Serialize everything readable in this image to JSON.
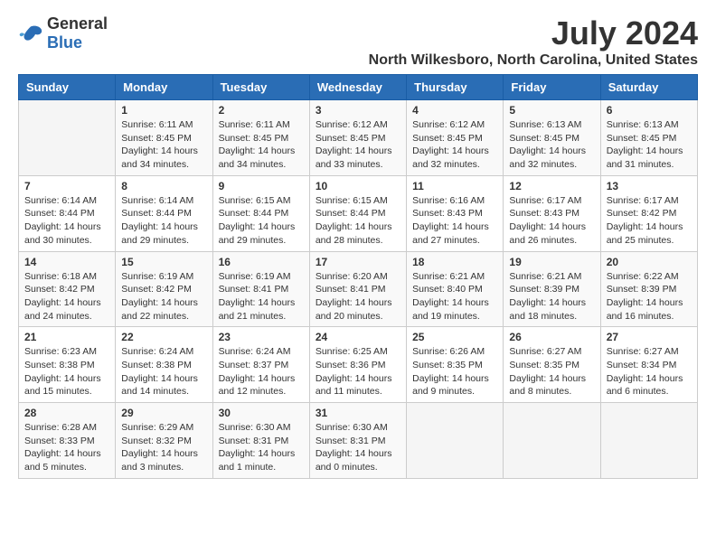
{
  "logo": {
    "text_general": "General",
    "text_blue": "Blue"
  },
  "title": "July 2024",
  "subtitle": "North Wilkesboro, North Carolina, United States",
  "days_header": [
    "Sunday",
    "Monday",
    "Tuesday",
    "Wednesday",
    "Thursday",
    "Friday",
    "Saturday"
  ],
  "weeks": [
    [
      {
        "day": "",
        "info": ""
      },
      {
        "day": "1",
        "info": "Sunrise: 6:11 AM\nSunset: 8:45 PM\nDaylight: 14 hours\nand 34 minutes."
      },
      {
        "day": "2",
        "info": "Sunrise: 6:11 AM\nSunset: 8:45 PM\nDaylight: 14 hours\nand 34 minutes."
      },
      {
        "day": "3",
        "info": "Sunrise: 6:12 AM\nSunset: 8:45 PM\nDaylight: 14 hours\nand 33 minutes."
      },
      {
        "day": "4",
        "info": "Sunrise: 6:12 AM\nSunset: 8:45 PM\nDaylight: 14 hours\nand 32 minutes."
      },
      {
        "day": "5",
        "info": "Sunrise: 6:13 AM\nSunset: 8:45 PM\nDaylight: 14 hours\nand 32 minutes."
      },
      {
        "day": "6",
        "info": "Sunrise: 6:13 AM\nSunset: 8:45 PM\nDaylight: 14 hours\nand 31 minutes."
      }
    ],
    [
      {
        "day": "7",
        "info": "Sunrise: 6:14 AM\nSunset: 8:44 PM\nDaylight: 14 hours\nand 30 minutes."
      },
      {
        "day": "8",
        "info": "Sunrise: 6:14 AM\nSunset: 8:44 PM\nDaylight: 14 hours\nand 29 minutes."
      },
      {
        "day": "9",
        "info": "Sunrise: 6:15 AM\nSunset: 8:44 PM\nDaylight: 14 hours\nand 29 minutes."
      },
      {
        "day": "10",
        "info": "Sunrise: 6:15 AM\nSunset: 8:44 PM\nDaylight: 14 hours\nand 28 minutes."
      },
      {
        "day": "11",
        "info": "Sunrise: 6:16 AM\nSunset: 8:43 PM\nDaylight: 14 hours\nand 27 minutes."
      },
      {
        "day": "12",
        "info": "Sunrise: 6:17 AM\nSunset: 8:43 PM\nDaylight: 14 hours\nand 26 minutes."
      },
      {
        "day": "13",
        "info": "Sunrise: 6:17 AM\nSunset: 8:42 PM\nDaylight: 14 hours\nand 25 minutes."
      }
    ],
    [
      {
        "day": "14",
        "info": "Sunrise: 6:18 AM\nSunset: 8:42 PM\nDaylight: 14 hours\nand 24 minutes."
      },
      {
        "day": "15",
        "info": "Sunrise: 6:19 AM\nSunset: 8:42 PM\nDaylight: 14 hours\nand 22 minutes."
      },
      {
        "day": "16",
        "info": "Sunrise: 6:19 AM\nSunset: 8:41 PM\nDaylight: 14 hours\nand 21 minutes."
      },
      {
        "day": "17",
        "info": "Sunrise: 6:20 AM\nSunset: 8:41 PM\nDaylight: 14 hours\nand 20 minutes."
      },
      {
        "day": "18",
        "info": "Sunrise: 6:21 AM\nSunset: 8:40 PM\nDaylight: 14 hours\nand 19 minutes."
      },
      {
        "day": "19",
        "info": "Sunrise: 6:21 AM\nSunset: 8:39 PM\nDaylight: 14 hours\nand 18 minutes."
      },
      {
        "day": "20",
        "info": "Sunrise: 6:22 AM\nSunset: 8:39 PM\nDaylight: 14 hours\nand 16 minutes."
      }
    ],
    [
      {
        "day": "21",
        "info": "Sunrise: 6:23 AM\nSunset: 8:38 PM\nDaylight: 14 hours\nand 15 minutes."
      },
      {
        "day": "22",
        "info": "Sunrise: 6:24 AM\nSunset: 8:38 PM\nDaylight: 14 hours\nand 14 minutes."
      },
      {
        "day": "23",
        "info": "Sunrise: 6:24 AM\nSunset: 8:37 PM\nDaylight: 14 hours\nand 12 minutes."
      },
      {
        "day": "24",
        "info": "Sunrise: 6:25 AM\nSunset: 8:36 PM\nDaylight: 14 hours\nand 11 minutes."
      },
      {
        "day": "25",
        "info": "Sunrise: 6:26 AM\nSunset: 8:35 PM\nDaylight: 14 hours\nand 9 minutes."
      },
      {
        "day": "26",
        "info": "Sunrise: 6:27 AM\nSunset: 8:35 PM\nDaylight: 14 hours\nand 8 minutes."
      },
      {
        "day": "27",
        "info": "Sunrise: 6:27 AM\nSunset: 8:34 PM\nDaylight: 14 hours\nand 6 minutes."
      }
    ],
    [
      {
        "day": "28",
        "info": "Sunrise: 6:28 AM\nSunset: 8:33 PM\nDaylight: 14 hours\nand 5 minutes."
      },
      {
        "day": "29",
        "info": "Sunrise: 6:29 AM\nSunset: 8:32 PM\nDaylight: 14 hours\nand 3 minutes."
      },
      {
        "day": "30",
        "info": "Sunrise: 6:30 AM\nSunset: 8:31 PM\nDaylight: 14 hours\nand 1 minute."
      },
      {
        "day": "31",
        "info": "Sunrise: 6:30 AM\nSunset: 8:31 PM\nDaylight: 14 hours\nand 0 minutes."
      },
      {
        "day": "",
        "info": ""
      },
      {
        "day": "",
        "info": ""
      },
      {
        "day": "",
        "info": ""
      }
    ]
  ]
}
